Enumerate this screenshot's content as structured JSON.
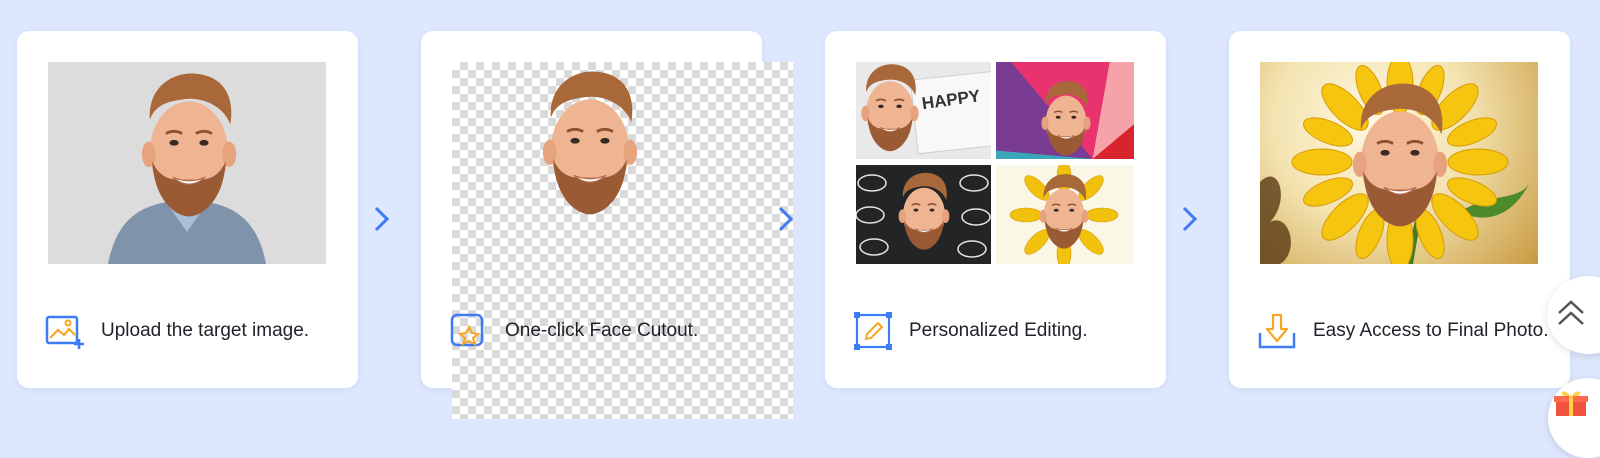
{
  "steps": [
    {
      "caption": "Upload the target image.",
      "icon": "upload-image-icon",
      "image": "portrait-photo"
    },
    {
      "caption": "One-click Face Cutout.",
      "icon": "face-cutout-icon",
      "image": "face-cutout-transparent"
    },
    {
      "caption": "Personalized Editing.",
      "icon": "edit-pencil-icon",
      "image": "edited-collage"
    },
    {
      "caption": "Easy Access to Final Photo.",
      "icon": "download-icon",
      "image": "sunflower-face-result"
    }
  ],
  "collage_note_text": "HAPPY",
  "colors": {
    "background": "#dde7fd",
    "card": "#ffffff",
    "accent_blue": "#3d7cf2",
    "accent_orange": "#f5a623",
    "text": "#20232b"
  },
  "floating": {
    "scroll_top_icon": "double-chevron-up-icon",
    "gift_icon": "gift-icon"
  }
}
